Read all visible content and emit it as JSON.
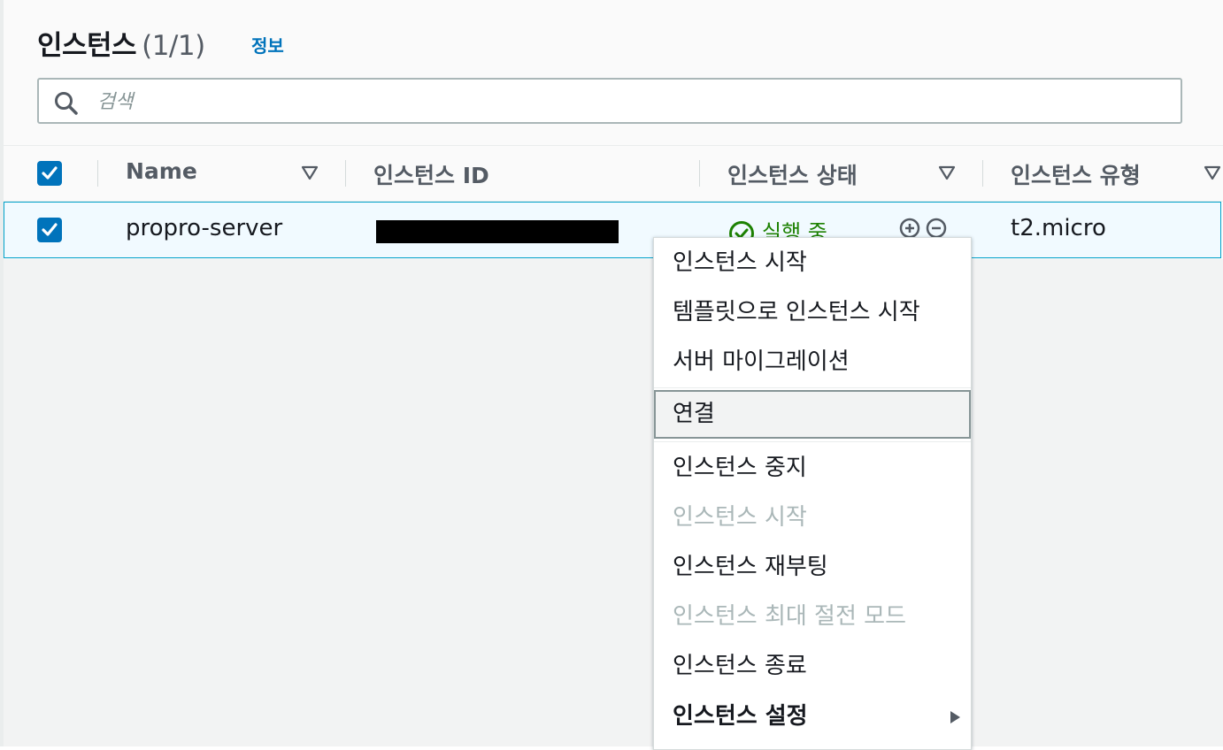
{
  "header": {
    "title": "인스턴스",
    "count": "(1/1)",
    "info_link": "정보"
  },
  "search": {
    "placeholder": "검색",
    "value": ""
  },
  "table": {
    "columns": [
      {
        "label": "Name",
        "sortable": true
      },
      {
        "label": "인스턴스 ID",
        "sortable": false
      },
      {
        "label": "인스턴스 상태",
        "sortable": true
      },
      {
        "label": "인스턴스 유형",
        "sortable": true
      }
    ],
    "header_checkbox_checked": true,
    "rows": [
      {
        "selected": true,
        "name": "propro-server",
        "instance_id": "",
        "instance_id_redacted": true,
        "state": "실행 중",
        "type": "t2.micro"
      }
    ]
  },
  "context_menu": {
    "items": [
      {
        "label": "인스턴스 시작",
        "enabled": true
      },
      {
        "label": "템플릿으로 인스턴스 시작",
        "enabled": true
      },
      {
        "label": "서버 마이그레이션",
        "enabled": true
      },
      {
        "label": "연결",
        "enabled": true,
        "highlighted": true
      },
      {
        "label": "인스턴스 중지",
        "enabled": true
      },
      {
        "label": "인스턴스 시작",
        "enabled": false
      },
      {
        "label": "인스턴스 재부팅",
        "enabled": true
      },
      {
        "label": "인스턴스 최대 절전 모드",
        "enabled": false
      },
      {
        "label": "인스턴스 종료",
        "enabled": true
      },
      {
        "label": "인스턴스 설정",
        "enabled": true,
        "submenu": true
      }
    ]
  },
  "colors": {
    "accent": "#0073bb",
    "running": "#1d8102",
    "selected_row_bg": "#f1faff",
    "selected_row_border": "#00a1c9",
    "disabled_text": "#aab7b8"
  },
  "icons": {
    "search": "search-icon",
    "sort": "sort-triangle-icon",
    "status": "check-circle-icon",
    "zoom_in": "zoom-in-icon",
    "zoom_out": "zoom-out-icon",
    "submenu": "caret-right-icon"
  }
}
